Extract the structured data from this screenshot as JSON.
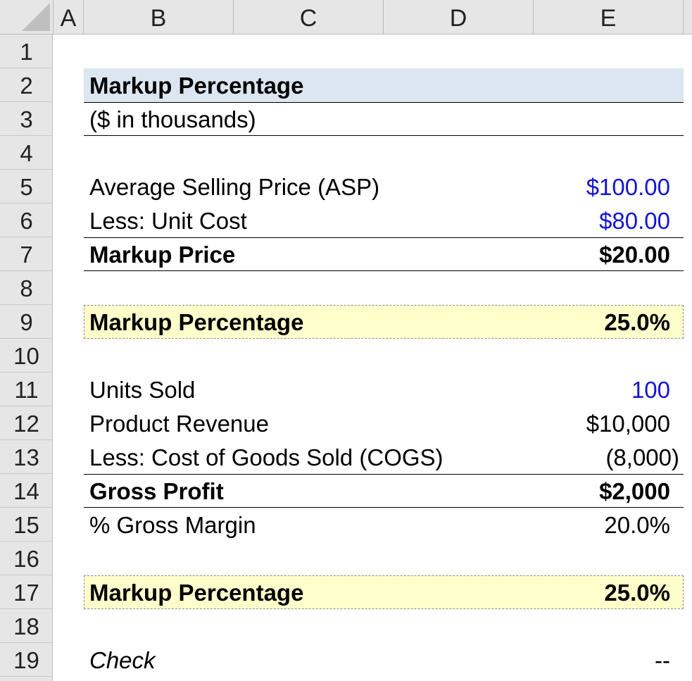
{
  "columns": [
    "A",
    "B",
    "C",
    "D",
    "E"
  ],
  "rows": [
    "1",
    "2",
    "3",
    "4",
    "5",
    "6",
    "7",
    "8",
    "9",
    "10",
    "11",
    "12",
    "13",
    "14",
    "15",
    "16",
    "17",
    "18",
    "19"
  ],
  "sheet": {
    "title": "Markup Percentage",
    "subtitle": "($ in thousands)",
    "asp_label": "Average Selling Price (ASP)",
    "asp_value": "$100.00",
    "unit_cost_label": "Less: Unit Cost",
    "unit_cost_value": "$80.00",
    "markup_price_label": "Markup Price",
    "markup_price_value": "$20.00",
    "markup_pct1_label": "Markup Percentage",
    "markup_pct1_value": "25.0%",
    "units_sold_label": "Units Sold",
    "units_sold_value": "100",
    "revenue_label": "Product Revenue",
    "revenue_value": "$10,000",
    "cogs_label": "Less: Cost of Goods Sold (COGS)",
    "cogs_value": "(8,000)",
    "gross_profit_label": "Gross Profit",
    "gross_profit_value": "$2,000",
    "gross_margin_label": "% Gross Margin",
    "gross_margin_value": "20.0%",
    "markup_pct2_label": "Markup Percentage",
    "markup_pct2_value": "25.0%",
    "check_label": "Check",
    "check_value": "--"
  },
  "colors": {
    "input_blue": "#1414d2",
    "title_band": "#dce6f1",
    "highlight_band": "#ffffcc",
    "header_gray": "#e6e6e6"
  }
}
